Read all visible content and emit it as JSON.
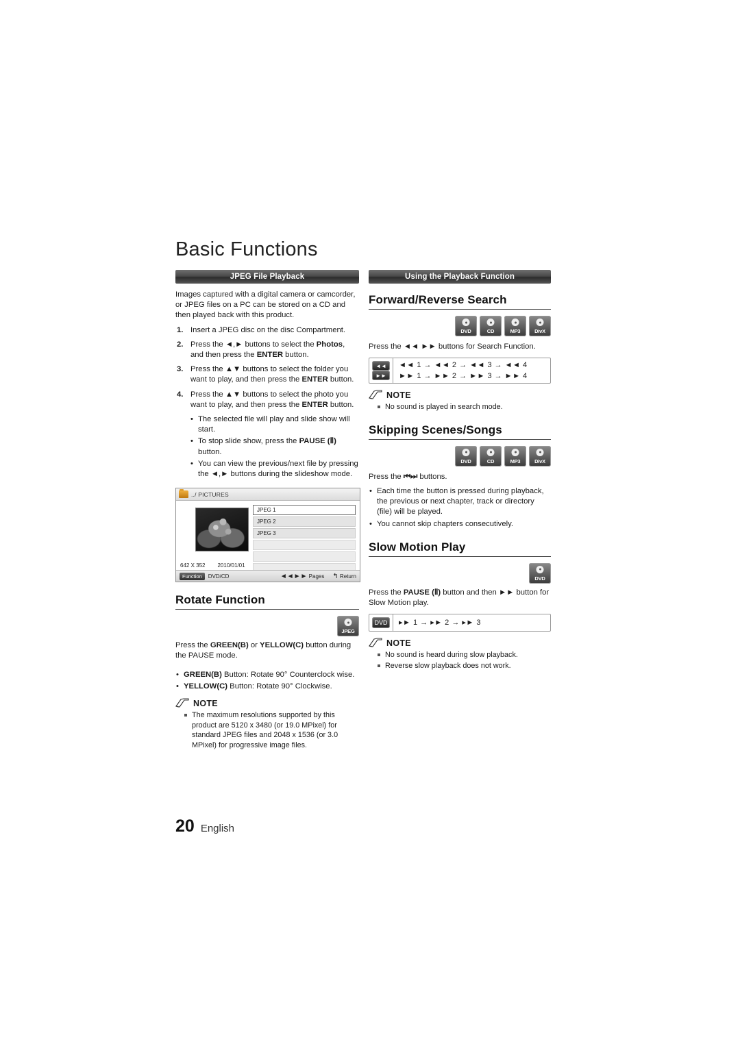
{
  "page": {
    "title": "Basic Functions",
    "footer_number": "20",
    "footer_language": "English"
  },
  "left_column": {
    "section_bar": "JPEG File Playback",
    "intro": "Images captured with a digital camera or camcorder, or JPEG files on a PC can be stored on a CD and then played back with this product.",
    "steps": [
      {
        "num": "1.",
        "text": "Insert a JPEG disc on the disc Compartment."
      },
      {
        "num": "2.",
        "text_pre": "Press the ",
        "arrows": "◄,►",
        "text_mid": " buttons to select the ",
        "bold1": "Photos",
        "text_mid2": ", and then press the ",
        "bold2": "ENTER",
        "text_post": " button."
      },
      {
        "num": "3.",
        "text_pre": "Press the ",
        "arrows": "▲▼",
        "text_mid": " buttons to select the folder you want to play, and then press the ",
        "bold2": "ENTER",
        "text_post": " button."
      },
      {
        "num": "4.",
        "text_pre": "Press the ",
        "arrows": "▲▼",
        "text_mid": " buttons to select the photo you want to play, and then press the ",
        "bold2": "ENTER",
        "text_post": " button."
      }
    ],
    "sub_bullets": [
      {
        "text": "The selected file will play and slide show will start."
      },
      {
        "pre": "To stop slide show, press the ",
        "bold": "PAUSE (Ⅱ)",
        "post": " button."
      },
      {
        "pre": "You can view the previous/next file by pressing the ",
        "arrows": "◄,►",
        "post": " buttons during the slideshow mode."
      }
    ],
    "screen": {
      "path_label": "../ PICTURES",
      "files": [
        "JPEG 1",
        "JPEG 2",
        "JPEG 3"
      ],
      "resolution": "642 X 352",
      "date": "2010/01/01",
      "function_tag": "Function",
      "disc_type": "DVD/CD",
      "pages_label": "Pages",
      "return_label": "Return",
      "pages_icon": "◄◄►►",
      "return_icon": "↰"
    },
    "rotate": {
      "heading": "Rotate Function",
      "badge": {
        "label": "JPEG"
      },
      "instruction_pre": "Press  the ",
      "instruction_b1": "GREEN(B)",
      "instruction_mid": " or ",
      "instruction_b2": "YELLOW(C)",
      "instruction_post": " button during the PAUSE mode.",
      "bullets": [
        {
          "bold": "GREEN(B)",
          "text": " Button: Rotate 90° Counterclock wise."
        },
        {
          "bold": "YELLOW(C)",
          "text": " Button: Rotate 90° Clockwise."
        }
      ],
      "note_label": "NOTE",
      "notes": [
        "The maximum resolutions supported by this product are 5120 x 3480 (or 19.0 MPixel) for standard JPEG files and 2048 x 1536 (or 3.0 MPixel) for progressive image files."
      ]
    }
  },
  "right_column": {
    "section_bar": "Using the Playback Function",
    "forward_reverse": {
      "heading": "Forward/Reverse Search",
      "badges": [
        "DVD",
        "CD",
        "MP3",
        "DivX"
      ],
      "instruction_pre": "Press the ",
      "instruction_icons": "◄◄ ►►",
      "instruction_post": " buttons for Search Function.",
      "key_rows": [
        {
          "button": "◄◄",
          "sequence": "◄◄ 1 → ◄◄ 2 → ◄◄ 3 → ◄◄ 4"
        },
        {
          "button": "►►",
          "sequence": "►► 1 → ►► 2 → ►► 3 → ►► 4"
        }
      ],
      "note_label": "NOTE",
      "notes": [
        "No sound is played in search mode."
      ]
    },
    "skipping": {
      "heading": "Skipping Scenes/Songs",
      "badges": [
        "DVD",
        "CD",
        "MP3",
        "DivX"
      ],
      "instruction_pre": "Press the ",
      "instruction_icons": "⏮⏭",
      "instruction_post": " buttons.",
      "bullets": [
        "Each time the button is pressed during playback, the previous or next chapter, track or directory (file) will be played.",
        "You cannot skip chapters consecutively."
      ]
    },
    "slow_motion": {
      "heading": "Slow Motion Play",
      "badges": [
        "DVD"
      ],
      "instruction_pre": "Press the ",
      "instruction_b1": "PAUSE (Ⅱ)",
      "instruction_mid": " button and then ",
      "instruction_icon": "►►",
      "instruction_post": " button for Slow Motion play.",
      "key_rows": [
        {
          "button": "DVD",
          "sequence": "▸► 1 → ▸► 2 → ▸► 3"
        }
      ],
      "note_label": "NOTE",
      "notes": [
        "No sound is heard during slow playback.",
        "Reverse slow playback does not work."
      ]
    }
  },
  "icons": {
    "note_icon": "note-pencil-icon"
  }
}
